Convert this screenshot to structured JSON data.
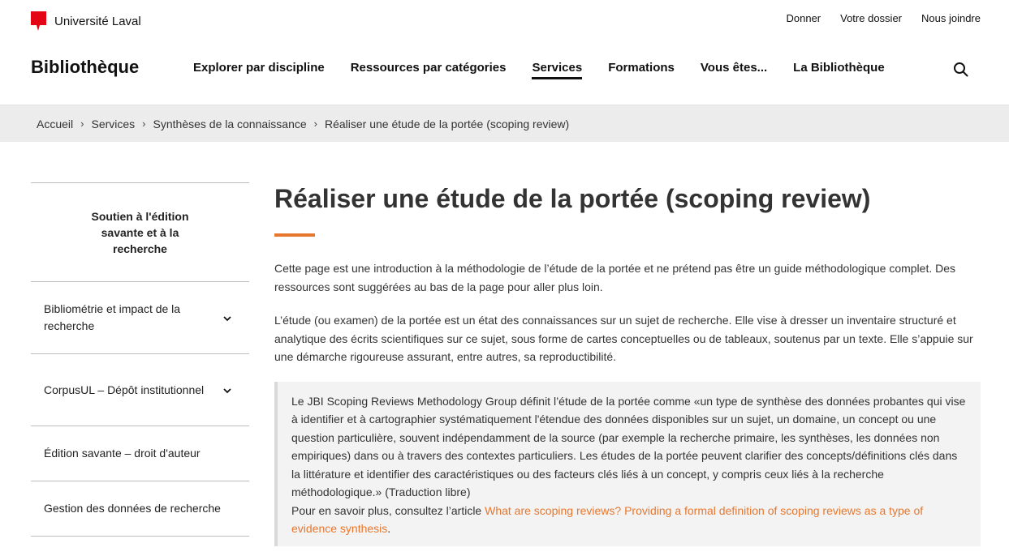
{
  "university": {
    "name": "Université Laval",
    "brand_color": "#e30513"
  },
  "utility_links": [
    "Donner",
    "Votre dossier",
    "Nous joindre"
  ],
  "site_title": "Bibliothèque",
  "nav": {
    "items": [
      {
        "label": "Explorer par discipline",
        "active": false
      },
      {
        "label": "Ressources par catégories",
        "active": false
      },
      {
        "label": "Services",
        "active": true
      },
      {
        "label": "Formations",
        "active": false
      },
      {
        "label": "Vous êtes...",
        "active": false
      },
      {
        "label": "La Bibliothèque",
        "active": false
      }
    ],
    "search_icon": "search-icon"
  },
  "breadcrumb": [
    "Accueil",
    "Services",
    "Synthèses de la connaissance",
    "Réaliser une étude de la portée (scoping review)"
  ],
  "sidebar": {
    "heading": "Soutien à l'édition savante et à la recherche",
    "items": [
      {
        "label": "Bibliométrie et impact de la recherche",
        "expandable": true
      },
      {
        "label": "CorpusUL – Dépôt institutionnel",
        "expandable": true
      },
      {
        "label": "Édition savante – droit d'auteur",
        "expandable": false
      },
      {
        "label": "Gestion des données de recherche",
        "expandable": false
      }
    ]
  },
  "main": {
    "title": "Réaliser une étude de la portée (scoping review)",
    "accent_color": "#e8772e",
    "intro": "Cette page est une introduction à la méthodologie de l’étude de la portée et ne prétend pas être un guide méthodologique complet. Des ressources sont suggérées au bas de la page pour aller plus loin.",
    "definition": "L’étude (ou examen) de la portée est un état des connaissances sur un sujet de recherche. Elle vise à dresser un inventaire structuré et analytique des écrits scientifiques sur ce sujet, sous forme de cartes conceptuelles ou de tableaux, soutenus par un texte. Elle s’appuie sur une démarche rigoureuse assurant, entre autres, sa reproductibilité.",
    "quote": {
      "text": "Le JBI Scoping Reviews Methodology Group définit l’étude de la portée comme «un type de synthèse des données probantes qui vise à identifier et à cartographier systématiquement l'étendue des données disponibles sur un sujet, un domaine, un concept ou une question particulière, souvent indépendamment de la source (par exemple la recherche primaire, les synthèses, les données non empiriques) dans ou à travers des contextes particuliers. Les études de la portée peuvent clarifier des concepts/définitions clés dans la littérature et identifier des caractéristiques ou des facteurs clés liés à un concept, y compris ceux liés à la recherche méthodologique.» (Traduction libre)",
      "more_prefix": "Pour en savoir plus, consultez l’article ",
      "link_text": "What are scoping reviews? Providing a formal definition of scoping reviews as a type of evidence synthesis",
      "suffix": "."
    }
  }
}
